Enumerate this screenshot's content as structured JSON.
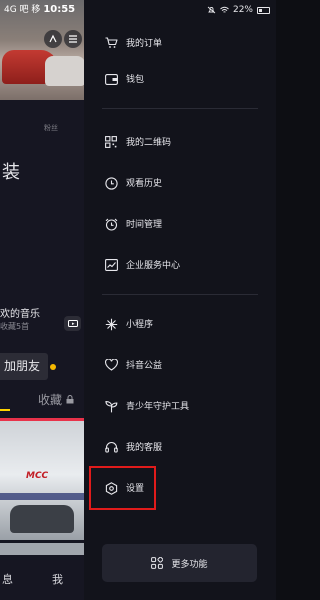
{
  "left_page": {
    "status_time": "10:55",
    "status_prefix": "4G 吧 移",
    "fans_label": "粉丝",
    "partial_char": "装",
    "music_title": "欢的音乐",
    "music_sub": "收藏5首",
    "add_friend": "加朋友",
    "fav_label": "收藏",
    "store_text": "MCC",
    "bottom_nav_left": "息",
    "bottom_nav_right": "我"
  },
  "status": {
    "battery": "22%"
  },
  "drawer": {
    "items": [
      {
        "label": "我的订单",
        "icon": "cart-icon"
      },
      {
        "label": "钱包",
        "icon": "wallet-icon"
      },
      {
        "label": "我的二维码",
        "icon": "qrcode-icon"
      },
      {
        "label": "观看历史",
        "icon": "history-clock-icon"
      },
      {
        "label": "时间管理",
        "icon": "alarm-clock-icon"
      },
      {
        "label": "企业服务中心",
        "icon": "chart-line-icon"
      },
      {
        "label": "小程序",
        "icon": "mini-program-icon"
      },
      {
        "label": "抖音公益",
        "icon": "heart-hands-icon"
      },
      {
        "label": "青少年守护工具",
        "icon": "sprout-icon"
      },
      {
        "label": "我的客服",
        "icon": "headset-icon"
      },
      {
        "label": "设置",
        "icon": "settings-hex-icon"
      }
    ],
    "more_label": "更多功能",
    "highlight_color": "#e01b1b"
  }
}
